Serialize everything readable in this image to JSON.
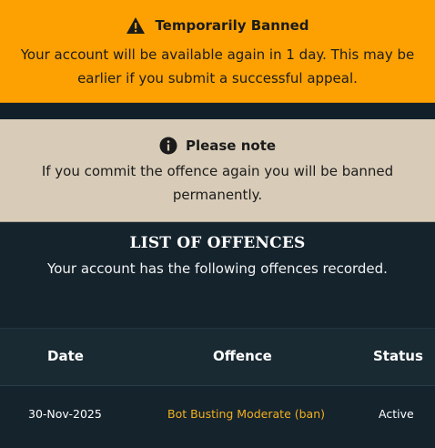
{
  "ban_banner": {
    "title": "Temporarily Banned",
    "message": "Your account will be available again in 1 day. This may be earlier if you submit a successful appeal.",
    "icon": "warning-icon",
    "background": "#fca101"
  },
  "note": {
    "title": "Please note",
    "message": "If you commit the offence again you will be banned permanently.",
    "icon": "info-icon",
    "background": "#d8ccb8"
  },
  "offences": {
    "heading": "LIST OF OFFENCES",
    "subtitle": "Your account has the following offences recorded.",
    "columns": [
      "Date",
      "Offence",
      "Status"
    ],
    "rows": [
      {
        "date": "30-Nov-2025",
        "offence": "Bot Busting Moderate (ban)",
        "status": "Active"
      }
    ],
    "offence_color": "#f2b01e"
  }
}
